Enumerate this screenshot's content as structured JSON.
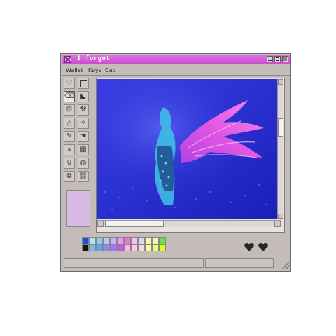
{
  "window": {
    "title": "I forgot"
  },
  "menu": {
    "items": [
      "Wallet",
      "Keys",
      "Cab"
    ]
  },
  "tools": [
    {
      "icon": "heart-outline-icon",
      "glyph": "♡"
    },
    {
      "icon": "dashed-select-icon",
      "glyph": ""
    },
    {
      "icon": "eraser-icon",
      "glyph": "⌫"
    },
    {
      "icon": "paint-bucket-icon",
      "glyph": "◣"
    },
    {
      "icon": "stamp-icon",
      "glyph": "⊞"
    },
    {
      "icon": "wrench-icon",
      "glyph": "⚒"
    },
    {
      "icon": "pyramid-icon",
      "glyph": "△"
    },
    {
      "icon": "magic-wand-icon",
      "glyph": "✧"
    },
    {
      "icon": "pencil-icon",
      "glyph": "✎"
    },
    {
      "icon": "hand-icon",
      "glyph": "☚"
    },
    {
      "icon": "compass-icon",
      "glyph": "⩚"
    },
    {
      "icon": "grid-icon",
      "glyph": "▦"
    },
    {
      "icon": "magnet-icon",
      "glyph": "∪"
    },
    {
      "icon": "globe-icon",
      "glyph": "◍"
    },
    {
      "icon": "layers-icon",
      "glyph": "⧉"
    },
    {
      "icon": "link-icon",
      "glyph": "⛓"
    }
  ],
  "palette": {
    "colors": [
      "#1c4fe0",
      "#aee2ff",
      "#8fcff5",
      "#b9c7ff",
      "#c8b1ff",
      "#f099f4",
      "#ef6fe6",
      "#f6c2f0",
      "#ddd6f0",
      "#fff3b0",
      "#e5ffab",
      "#6de04a",
      "#141414",
      "#7ab7f4",
      "#58a8f0",
      "#7e8cff",
      "#9f78ff",
      "#c955f0",
      "#ffb3f2",
      "#ffc8e6",
      "#f4d7e2",
      "#fff79b",
      "#e8ff6a",
      "#d9ff28"
    ]
  },
  "colors": {
    "title_bar": "#d35fd9",
    "window_bg": "#c4bcb8",
    "canvas_blue": "#2a2fd8",
    "wing_pink": "#e84fe6",
    "heart": "#2a2626"
  },
  "hearts": [
    "heart-icon",
    "heart-icon"
  ]
}
